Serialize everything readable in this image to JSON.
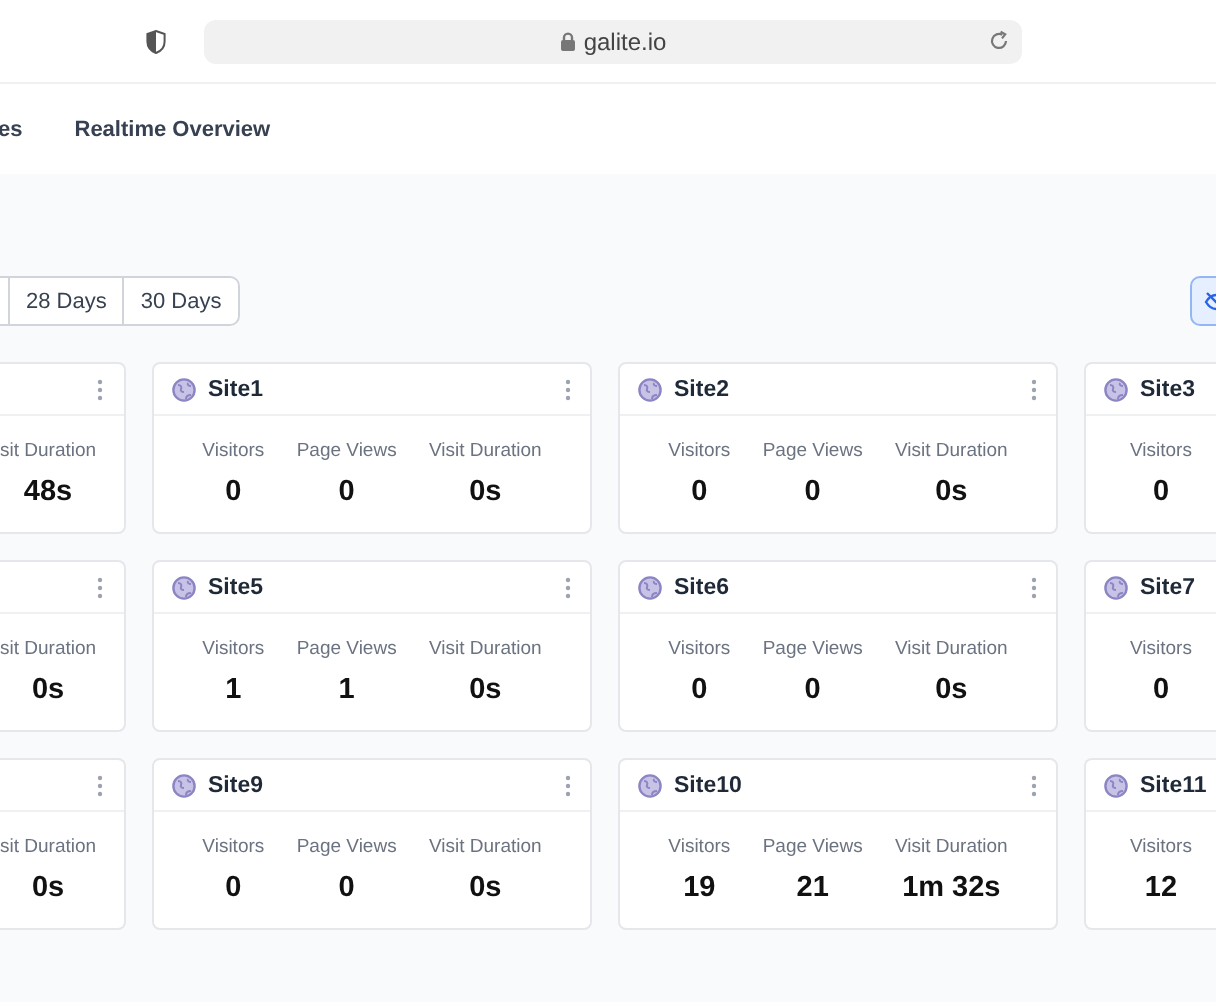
{
  "browser": {
    "url": "galite.io"
  },
  "nav": {
    "tabs": [
      {
        "label": "es"
      },
      {
        "label": "Realtime Overview"
      }
    ]
  },
  "range_buttons": [
    {
      "kind": "cut"
    },
    {
      "kind": "full",
      "label": "28 Days"
    },
    {
      "kind": "full",
      "label": "30 Days"
    }
  ],
  "sites": [
    {
      "kind": "cut-left",
      "stats": [
        {
          "label": "sit Duration",
          "value": "48s"
        }
      ]
    },
    {
      "kind": "full",
      "name": "Site1",
      "stats": [
        {
          "label": "Visitors",
          "value": "0"
        },
        {
          "label": "Page Views",
          "value": "0"
        },
        {
          "label": "Visit Duration",
          "value": "0s"
        }
      ]
    },
    {
      "kind": "full",
      "name": "Site2",
      "stats": [
        {
          "label": "Visitors",
          "value": "0"
        },
        {
          "label": "Page Views",
          "value": "0"
        },
        {
          "label": "Visit Duration",
          "value": "0s"
        }
      ]
    },
    {
      "kind": "cut-right",
      "name": "Site3",
      "stats": [
        {
          "label": "Visitors",
          "value": "0"
        }
      ]
    },
    {
      "kind": "cut-left",
      "stats": [
        {
          "label": "sit Duration",
          "value": "0s"
        }
      ]
    },
    {
      "kind": "full",
      "name": "Site5",
      "stats": [
        {
          "label": "Visitors",
          "value": "1"
        },
        {
          "label": "Page Views",
          "value": "1"
        },
        {
          "label": "Visit Duration",
          "value": "0s"
        }
      ]
    },
    {
      "kind": "full",
      "name": "Site6",
      "stats": [
        {
          "label": "Visitors",
          "value": "0"
        },
        {
          "label": "Page Views",
          "value": "0"
        },
        {
          "label": "Visit Duration",
          "value": "0s"
        }
      ]
    },
    {
      "kind": "cut-right",
      "name": "Site7",
      "stats": [
        {
          "label": "Visitors",
          "value": "0"
        }
      ]
    },
    {
      "kind": "cut-left",
      "stats": [
        {
          "label": "sit Duration",
          "value": "0s"
        }
      ]
    },
    {
      "kind": "full",
      "name": "Site9",
      "stats": [
        {
          "label": "Visitors",
          "value": "0"
        },
        {
          "label": "Page Views",
          "value": "0"
        },
        {
          "label": "Visit Duration",
          "value": "0s"
        }
      ]
    },
    {
      "kind": "full",
      "name": "Site10",
      "stats": [
        {
          "label": "Visitors",
          "value": "19"
        },
        {
          "label": "Page Views",
          "value": "21"
        },
        {
          "label": "Visit Duration",
          "value": "1m 32s"
        }
      ]
    },
    {
      "kind": "cut-right",
      "name": "Site11",
      "stats": [
        {
          "label": "Visitors",
          "value": "12"
        }
      ]
    }
  ]
}
